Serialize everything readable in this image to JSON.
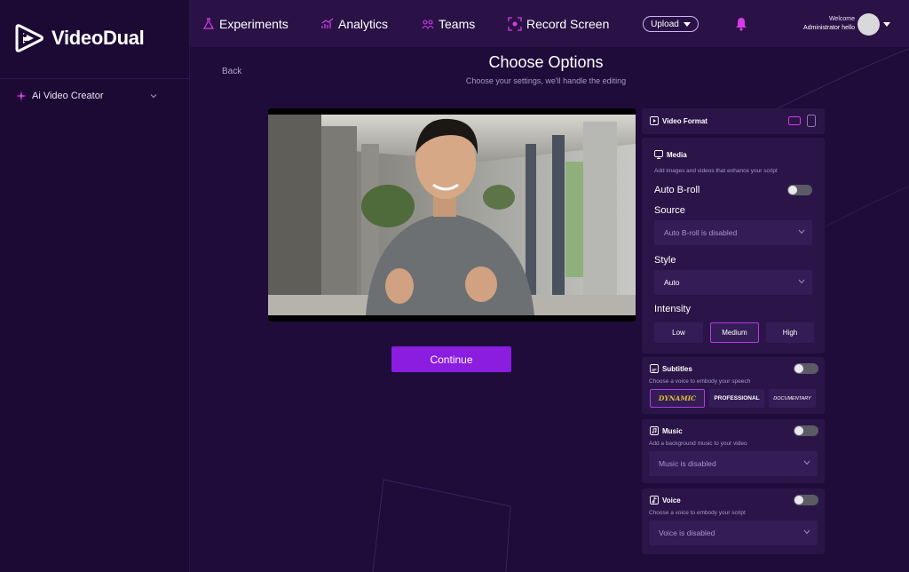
{
  "brand": {
    "name": "VideoDual"
  },
  "sidebar": {
    "item_label": "Ai Video Creator"
  },
  "nav": {
    "experiments": "Experiments",
    "analytics": "Analytics",
    "teams": "Teams",
    "record": "Record Screen",
    "upload": "Upload"
  },
  "user": {
    "welcome": "Welcome",
    "name": "Administrator hello"
  },
  "page": {
    "back": "Back",
    "title": "Choose Options",
    "subtitle": "Choose your settings, we'll handle the editing",
    "continue": "Continue"
  },
  "panel": {
    "video_format": {
      "title": "Video Format"
    },
    "media": {
      "title": "Media",
      "desc": "Add images and videos that enhance your script",
      "auto_broll": "Auto B-roll",
      "source_label": "Source",
      "source_value": "Auto B-roll is disabled",
      "style_label": "Style",
      "style_value": "Auto",
      "intensity_label": "Intensity",
      "intensity_options": [
        "Low",
        "Medium",
        "High"
      ],
      "intensity_selected": "Medium"
    },
    "subtitles": {
      "title": "Subtitles",
      "desc": "Choose a voice to embody your speech",
      "styles": [
        "DYNAMIC",
        "PROFESSIONAL",
        "DOCUMENTARY"
      ],
      "selected": "DYNAMIC"
    },
    "music": {
      "title": "Music",
      "desc": "Add a background music to your video",
      "value": "Music is disabled"
    },
    "voice": {
      "title": "Voice",
      "desc": "Choose a voice to embody your script",
      "value": "Voice is disabled"
    }
  },
  "colors": {
    "background": "#1f0c3a",
    "topbar": "#2a1247",
    "accent": "#8a1de0",
    "accent_pink": "#d63be8"
  }
}
